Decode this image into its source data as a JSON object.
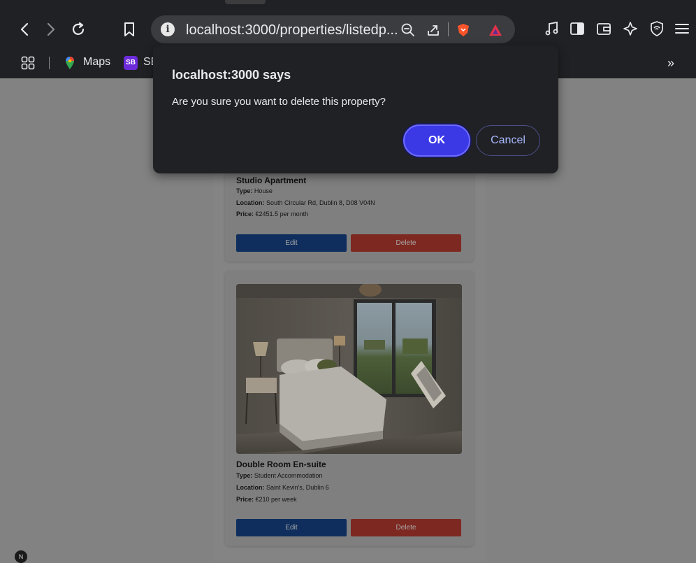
{
  "browser": {
    "address": "localhost:3000/properties/listedp...",
    "bookmarks": [
      {
        "label": "Maps"
      },
      {
        "icon_text": "SB",
        "label": "SE"
      }
    ],
    "more_label": "»"
  },
  "dialog": {
    "title": "localhost:3000 says",
    "message": "Are you sure you want to delete this property?",
    "ok_label": "OK",
    "cancel_label": "Cancel"
  },
  "properties": [
    {
      "title": "Studio Apartment",
      "type_label": "Type:",
      "type": "House",
      "location_label": "Location:",
      "location": "South Circular Rd, Dublin 8, D08 V04N",
      "price_label": "Price:",
      "price": "€2451.5 per month",
      "edit_label": "Edit",
      "delete_label": "Delete"
    },
    {
      "title": "Double Room En-suite",
      "type_label": "Type:",
      "type": "Student Accommodation",
      "location_label": "Location:",
      "location": "Saint Kevin's, Dublin 6",
      "price_label": "Price:",
      "price": "€210 per week",
      "edit_label": "Edit",
      "delete_label": "Delete"
    }
  ],
  "corner_badge": "N"
}
